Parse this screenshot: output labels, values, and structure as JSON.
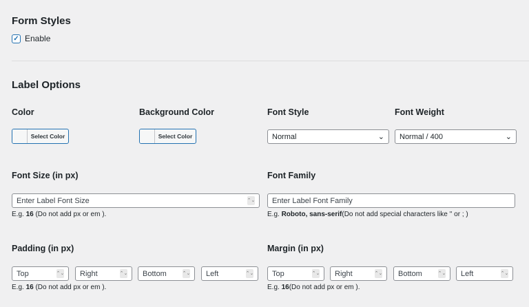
{
  "form_styles": {
    "title": "Form Styles",
    "enable_label": "Enable",
    "enabled": true
  },
  "label_options": {
    "title": "Label Options",
    "color": {
      "label": "Color",
      "button": "Select Color"
    },
    "background_color": {
      "label": "Background Color",
      "button": "Select Color"
    },
    "font_style": {
      "label": "Font Style",
      "value": "Normal"
    },
    "font_weight": {
      "label": "Font Weight",
      "value": "Normal / 400"
    },
    "font_size": {
      "label": "Font Size (in px)",
      "placeholder": "Enter Label Font Size",
      "help_prefix": "E.g. ",
      "help_bold": "16",
      "help_suffix": " (Do not add px or em )."
    },
    "font_family": {
      "label": "Font Family",
      "placeholder": "Enter Label Font Family",
      "help_prefix": "E.g. ",
      "help_bold": "Roboto, sans-serif",
      "help_suffix": "(Do not add special characters like '' or ; )"
    },
    "padding": {
      "label": "Padding (in px)",
      "fields": [
        "Top",
        "Right",
        "Bottom",
        "Left"
      ],
      "help_prefix": "E.g. ",
      "help_bold": "16",
      "help_suffix": " (Do not add px or em )."
    },
    "margin": {
      "label": "Margin (in px)",
      "fields": [
        "Top",
        "Right",
        "Bottom",
        "Left"
      ],
      "help_prefix": "E.g. ",
      "help_bold": "16",
      "help_suffix": "(Do not add px or em )."
    }
  }
}
